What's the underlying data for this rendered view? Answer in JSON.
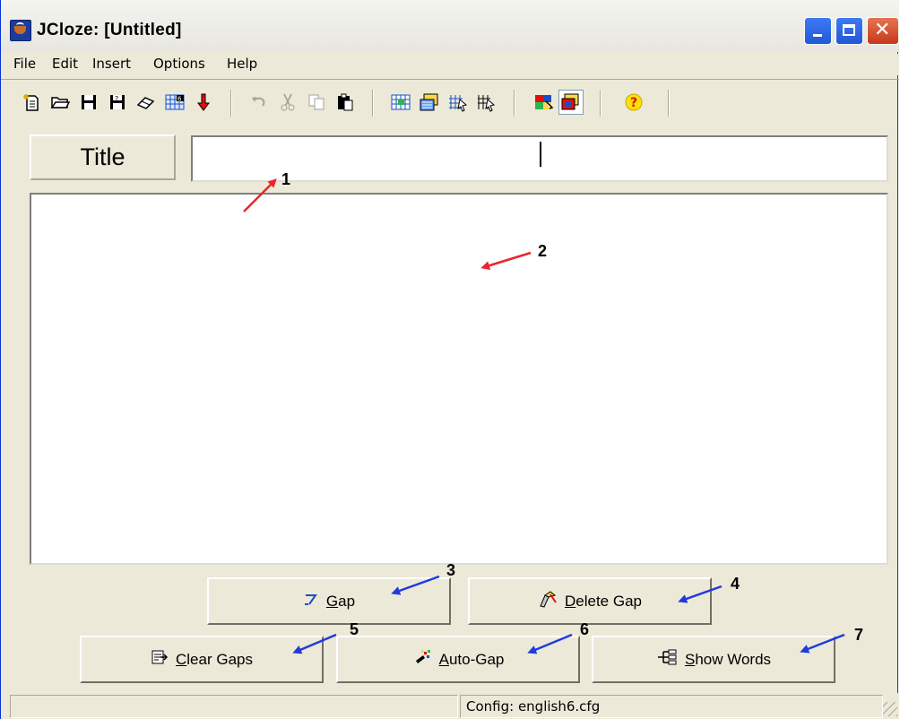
{
  "window": {
    "title": "JCloze: [Untitled]",
    "controls": [
      "minimize",
      "maximize",
      "close"
    ]
  },
  "menubar": {
    "items": [
      {
        "label": "File"
      },
      {
        "label": "Edit"
      },
      {
        "label": "Insert"
      },
      {
        "label": "Options"
      },
      {
        "label": "Help"
      }
    ]
  },
  "toolbar": {
    "groups": [
      [
        "new-file-icon",
        "open-folder-icon",
        "save-icon",
        "save-as-icon",
        "eraser-icon",
        "web-page-icon",
        "export-arrow-icon"
      ],
      [
        "undo-icon",
        "cut-icon",
        "copy-icon",
        "paste-icon"
      ],
      [
        "create-web-page-icon",
        "export-dhtml-icon",
        "export-drag-drop-icon",
        "export-hotpotatoes-icon"
      ],
      [
        "configure-output-icon",
        "view-settings-icon"
      ],
      [
        "help-icon"
      ]
    ],
    "active": "view-settings-icon",
    "disabled": [
      "undo-icon",
      "cut-icon",
      "copy-icon"
    ]
  },
  "title_section": {
    "label": "Title",
    "input_value": ""
  },
  "main_text": {
    "value": ""
  },
  "buttons": {
    "gap": {
      "label": "Gap",
      "underline": "G",
      "icon": "gap-icon"
    },
    "delete_gap": {
      "label": "Delete Gap",
      "underline": "D",
      "icon": "eraser-icon"
    },
    "clear_gaps": {
      "label": "Clear Gaps",
      "underline": "C",
      "icon": "clear-gaps-icon"
    },
    "auto_gap": {
      "label": "Auto-Gap",
      "underline": "A",
      "icon": "magic-wand-icon"
    },
    "show_words": {
      "label": "Show Words",
      "underline": "S",
      "icon": "tree-icon"
    }
  },
  "statusbar": {
    "left": "",
    "config": "Config: english6.cfg"
  },
  "annotations": [
    {
      "number": "1",
      "color": "#e8262b",
      "target": "title-input"
    },
    {
      "number": "2",
      "color": "#e8262b",
      "target": "main-text-area"
    },
    {
      "number": "3",
      "color": "#1f3ae0",
      "target": "gap-button"
    },
    {
      "number": "4",
      "color": "#1f3ae0",
      "target": "delete-gap-button"
    },
    {
      "number": "5",
      "color": "#1f3ae0",
      "target": "clear-gaps-button"
    },
    {
      "number": "6",
      "color": "#1f3ae0",
      "target": "auto-gap-button"
    },
    {
      "number": "7",
      "color": "#1f3ae0",
      "target": "show-words-button"
    }
  ]
}
